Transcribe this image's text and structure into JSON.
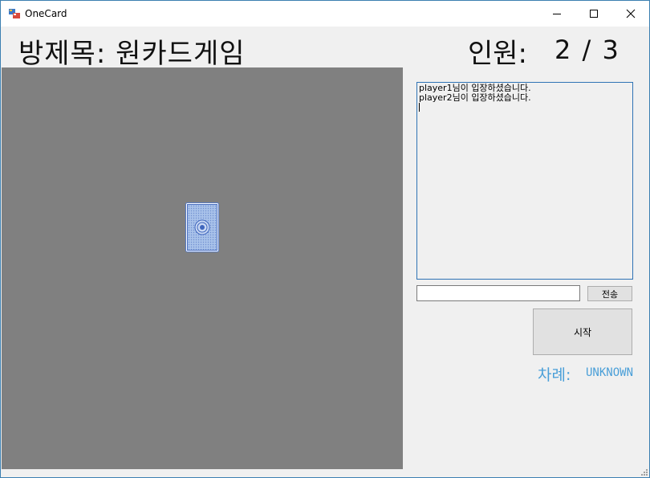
{
  "window": {
    "title": "OneCard",
    "icons": {
      "app": "app-icon",
      "minimize": "minimize-icon",
      "maximize": "maximize-icon",
      "close": "close-icon"
    }
  },
  "header": {
    "room_title": "방제목: 원카드게임",
    "player_count_label": "인원:",
    "player_count_value": "2 / 3"
  },
  "board": {
    "card": "card-back",
    "background_color": "#808080"
  },
  "chat": {
    "messages": [
      "player1님이 입장하셨습니다.",
      "player2님이 입장하셨습니다."
    ],
    "input_value": "",
    "send_label": "전송"
  },
  "controls": {
    "start_label": "시작",
    "turn_label": "차례:",
    "turn_value": "UNKNOWN",
    "accent_color": "#4a9fd8"
  }
}
